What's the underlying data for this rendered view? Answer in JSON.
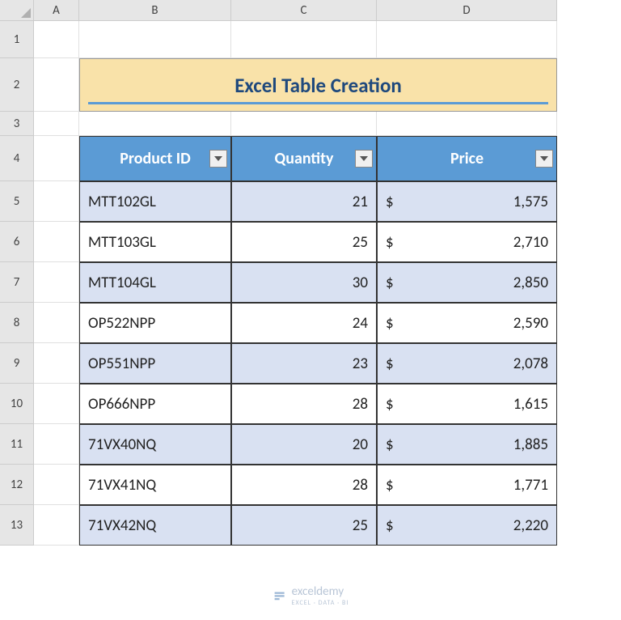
{
  "columns": [
    "A",
    "B",
    "C",
    "D"
  ],
  "rowNumbers": [
    "1",
    "2",
    "3",
    "4",
    "5",
    "6",
    "7",
    "8",
    "9",
    "10",
    "11",
    "12",
    "13"
  ],
  "title": "Excel Table Creation",
  "table": {
    "headers": [
      "Product ID",
      "Quantity",
      "Price"
    ],
    "rows": [
      {
        "id": "MTT102GL",
        "qty": "21",
        "currency": "$",
        "price": "1,575"
      },
      {
        "id": "MTT103GL",
        "qty": "25",
        "currency": "$",
        "price": "2,710"
      },
      {
        "id": "MTT104GL",
        "qty": "30",
        "currency": "$",
        "price": "2,850"
      },
      {
        "id": "OP522NPP",
        "qty": "24",
        "currency": "$",
        "price": "2,590"
      },
      {
        "id": "OP551NPP",
        "qty": "23",
        "currency": "$",
        "price": "2,078"
      },
      {
        "id": "OP666NPP",
        "qty": "28",
        "currency": "$",
        "price": "1,615"
      },
      {
        "id": "71VX40NQ",
        "qty": "20",
        "currency": "$",
        "price": "1,885"
      },
      {
        "id": "71VX41NQ",
        "qty": "28",
        "currency": "$",
        "price": "1,771"
      },
      {
        "id": "71VX42NQ",
        "qty": "25",
        "currency": "$",
        "price": "2,220"
      }
    ]
  },
  "watermark": {
    "name": "exceldemy",
    "tagline": "EXCEL · DATA · BI"
  },
  "colors": {
    "titleBg": "#f9e2a9",
    "titleText": "#1f497d",
    "headerBg": "#5b9bd5",
    "bandedBg": "#d9e1f2",
    "underline": "#5b9bd5"
  }
}
